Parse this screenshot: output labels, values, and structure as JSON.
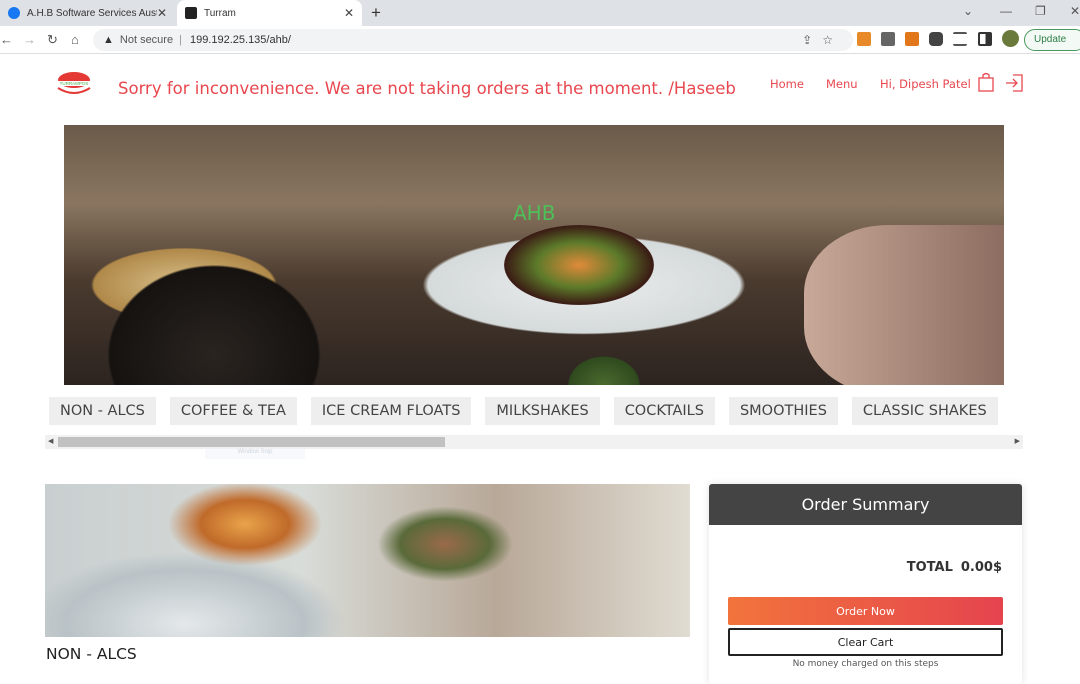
{
  "browser": {
    "tabs": [
      {
        "title": "A.H.B Software Services Australia",
        "icon": "facebook-icon",
        "active": false
      },
      {
        "title": "Turram",
        "icon": "angular-icon",
        "active": true
      }
    ],
    "security": "Not secure",
    "url": "199.192.25.135/ahb/",
    "update_label": "Update",
    "extensions": [
      "superfluid-icon",
      "lightbulb-icon",
      "metamask-icon",
      "puzzle-icon",
      "reading-list-icon",
      "sidepanel-icon",
      "profile-avatar"
    ]
  },
  "header": {
    "logo_text": "TURRAMPOS",
    "notice": "Sorry for inconvenience. We are not taking orders at the moment. /Haseeb",
    "nav": {
      "home": "Home",
      "menu": "Menu",
      "user": "Hi, Dipesh Patel"
    },
    "accent": "#e8474f"
  },
  "hero": {
    "brand": "AHB"
  },
  "categories": [
    "NON - ALCS",
    "COFFEE & TEA",
    "ICE CREAM FLOATS",
    "MILKSHAKES",
    "COCKTAILS",
    "SMOOTHIES",
    "CLASSIC SHAKES"
  ],
  "tooltip": "Window Snip",
  "section": {
    "title": "NON - ALCS"
  },
  "order_summary": {
    "title": "Order Summary",
    "total_label": "TOTAL",
    "total_value": "0.00$",
    "order_now": "Order Now",
    "clear_cart": "Clear Cart",
    "note": "No money charged on this steps"
  }
}
